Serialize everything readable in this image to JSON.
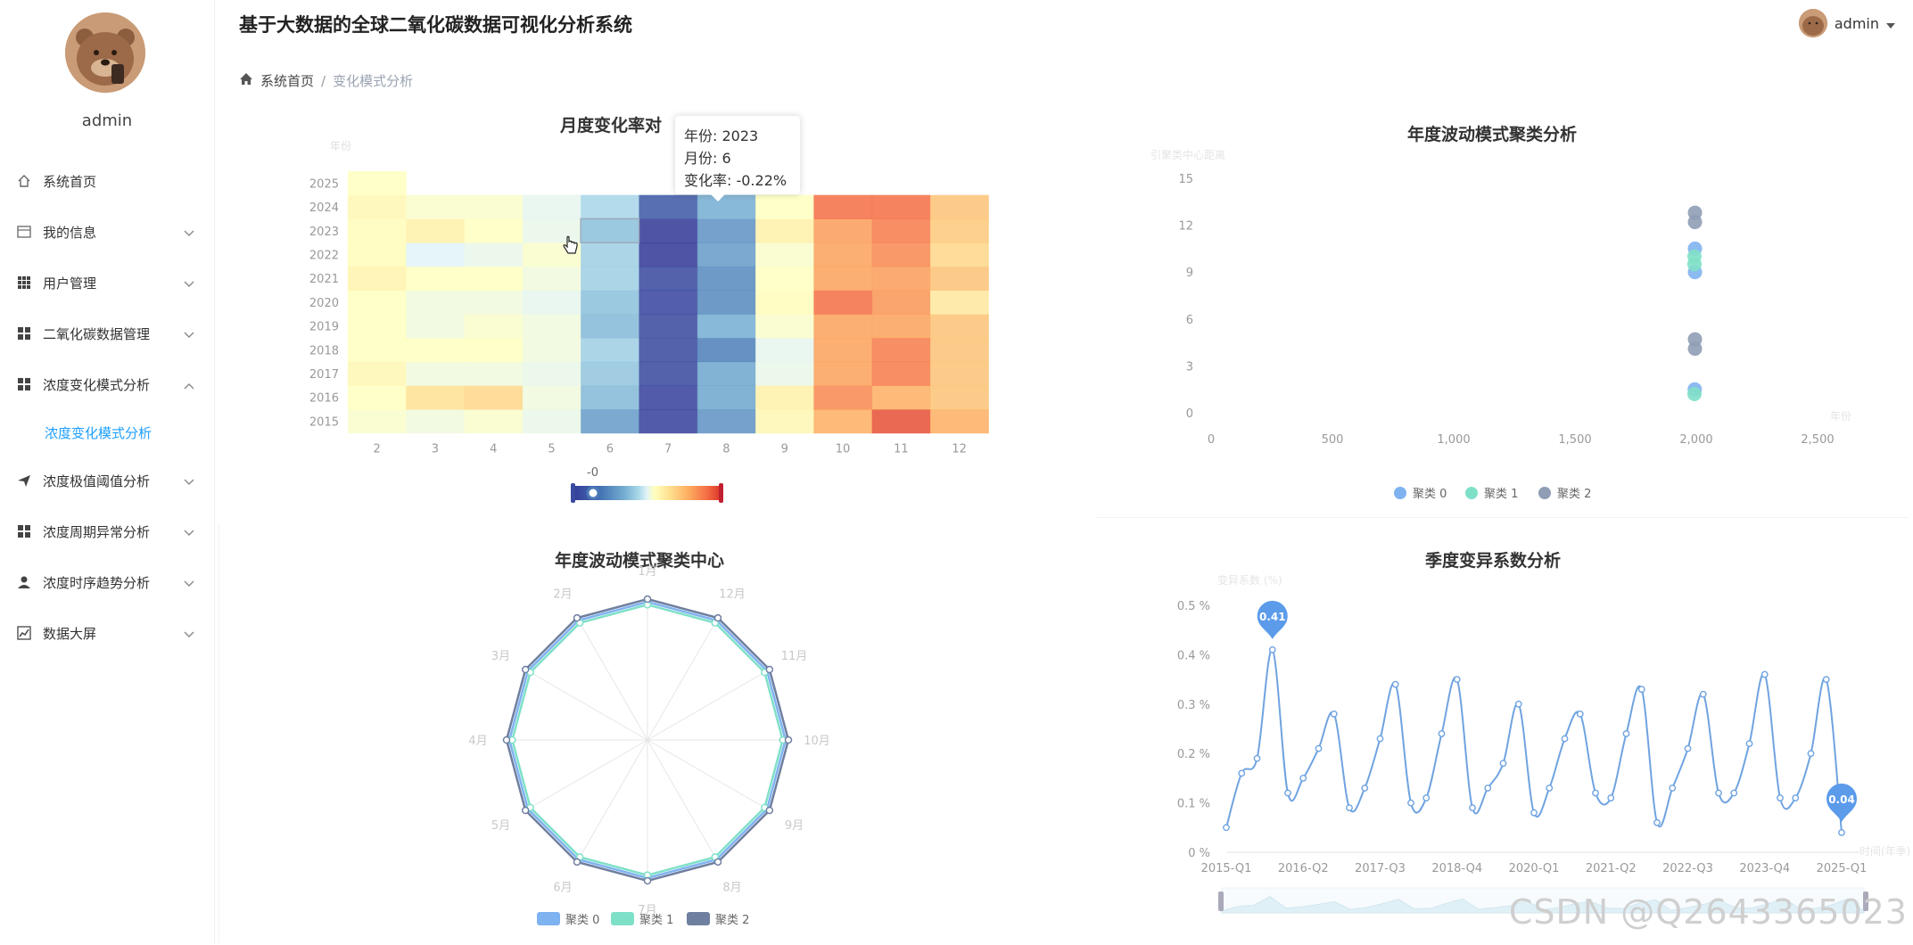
{
  "app": {
    "title": "基于大数据的全球二氧化碳数据可视化分析系统",
    "user": "admin"
  },
  "sidebar": {
    "user_name": "admin",
    "items": [
      {
        "label": "系统首页",
        "icon": "home-icon",
        "expandable": false
      },
      {
        "label": "我的信息",
        "icon": "card-icon",
        "expandable": true
      },
      {
        "label": "用户管理",
        "icon": "grid-icon",
        "expandable": true
      },
      {
        "label": "二氧化碳数据管理",
        "icon": "grid-icon",
        "expandable": true
      },
      {
        "label": "浓度变化模式分析",
        "icon": "grid-icon",
        "expandable": true,
        "expanded": true
      },
      {
        "label": "浓度变化模式分析",
        "icon": "",
        "sub": true,
        "active": true
      },
      {
        "label": "浓度极值阈值分析",
        "icon": "send-icon",
        "expandable": true
      },
      {
        "label": "浓度周期异常分析",
        "icon": "grid-icon",
        "expandable": true
      },
      {
        "label": "浓度时序趋势分析",
        "icon": "user-icon",
        "expandable": true
      },
      {
        "label": "数据大屏",
        "icon": "chart-icon",
        "expandable": true
      }
    ]
  },
  "breadcrumb": {
    "home": "系统首页",
    "sep": "/",
    "current": "变化模式分析"
  },
  "tooltip": {
    "line1": "年份: 2023",
    "line2": "月份: 6",
    "line3": "变化率: -0.22%"
  },
  "watermark": "CSDN @Q2643365023",
  "colors": {
    "accent": "#1e9fff",
    "line": "#6fa3e0",
    "cluster0": "#7fb2f0",
    "cluster1": "#7fe0c8",
    "cluster2": "#8f9db5"
  },
  "chart_data": [
    {
      "type": "heatmap",
      "title": "月度变化率对",
      "ylabel": "年份",
      "x": [
        "2",
        "3",
        "4",
        "5",
        "6",
        "7",
        "8",
        "9",
        "10",
        "11",
        "12"
      ],
      "y": [
        "2015",
        "2016",
        "2017",
        "2018",
        "2019",
        "2020",
        "2021",
        "2022",
        "2023",
        "2024",
        "2025"
      ],
      "visual_map_label": "-0",
      "values": [
        [
          0.08,
          0.05,
          0.08,
          0.03,
          -0.4,
          -0.95,
          -0.45,
          0.15,
          0.55,
          0.9,
          0.55
        ],
        [
          0.1,
          0.3,
          0.35,
          0.05,
          -0.25,
          -0.95,
          -0.35,
          0.2,
          0.7,
          0.55,
          0.45
        ],
        [
          0.15,
          0.05,
          0.05,
          0.03,
          -0.2,
          -0.9,
          -0.35,
          0.03,
          0.6,
          0.75,
          0.45
        ],
        [
          0.1,
          0.1,
          0.1,
          0.05,
          -0.15,
          -0.9,
          -0.55,
          0.02,
          0.6,
          0.75,
          0.45
        ],
        [
          0.1,
          0.05,
          0.08,
          0.05,
          -0.25,
          -0.9,
          -0.3,
          0.08,
          0.6,
          0.6,
          0.45
        ],
        [
          0.1,
          0.05,
          0.05,
          0.02,
          -0.22,
          -0.92,
          -0.5,
          0.12,
          0.8,
          0.65,
          0.25
        ],
        [
          0.18,
          0.1,
          0.1,
          0.05,
          -0.15,
          -0.9,
          -0.5,
          0.1,
          0.6,
          0.62,
          0.45
        ],
        [
          0.12,
          0.0,
          0.03,
          0.08,
          -0.15,
          -1.0,
          -0.4,
          0.08,
          0.6,
          0.7,
          0.35
        ],
        [
          0.12,
          0.2,
          0.1,
          0.03,
          -0.22,
          -1.0,
          -0.45,
          0.2,
          0.62,
          0.75,
          0.42
        ],
        [
          0.15,
          0.08,
          0.08,
          0.02,
          -0.12,
          -0.8,
          -0.3,
          0.1,
          0.8,
          0.8,
          0.45
        ],
        [
          0.1,
          null,
          null,
          null,
          null,
          null,
          null,
          null,
          null,
          null,
          null
        ]
      ]
    },
    {
      "type": "scatter",
      "title": "年度波动模式聚类分析",
      "ylabel": "引聚类中心距离",
      "xlabel": "年份",
      "xlim": [
        0,
        2500
      ],
      "ylim": [
        0,
        15
      ],
      "xticks": [
        "0",
        "500",
        "1,000",
        "1,500",
        "2,000",
        "2,500"
      ],
      "yticks": [
        "0",
        "3",
        "6",
        "9",
        "12",
        "15"
      ],
      "series": [
        {
          "name": "聚类 0",
          "points": [
            [
              2024,
              10.5
            ],
            [
              2024,
              9.0
            ],
            [
              2023,
              1.5
            ]
          ]
        },
        {
          "name": "聚类 1",
          "points": [
            [
              2022,
              10.0
            ],
            [
              2022,
              9.5
            ],
            [
              2022,
              1.2
            ]
          ]
        },
        {
          "name": "聚类 2",
          "points": [
            [
              2024,
              12.8
            ],
            [
              2024,
              12.2
            ],
            [
              2024,
              4.7
            ],
            [
              2024,
              4.1
            ]
          ]
        }
      ]
    },
    {
      "type": "radar",
      "title": "年度波动模式聚类中心",
      "indicators": [
        "1月",
        "12月",
        "11月",
        "10月",
        "9月",
        "8月",
        "7月",
        "6月",
        "5月",
        "4月",
        "3月",
        "2月"
      ],
      "series": [
        {
          "name": "聚类 0",
          "values": [
            0.98,
            0.98,
            0.98,
            0.98,
            0.98,
            0.98,
            0.98,
            0.98,
            0.98,
            0.98,
            0.98,
            0.98
          ]
        },
        {
          "name": "聚类 1",
          "values": [
            0.96,
            0.96,
            0.96,
            0.96,
            0.96,
            0.96,
            0.96,
            0.96,
            0.96,
            0.96,
            0.96,
            0.96
          ]
        },
        {
          "name": "聚类 2",
          "values": [
            1.0,
            1.0,
            1.0,
            1.0,
            1.0,
            1.0,
            1.0,
            1.0,
            1.0,
            1.0,
            1.0,
            1.0
          ]
        }
      ]
    },
    {
      "type": "line",
      "title": "季度变异系数分析",
      "ylabel": "变异系数 (%)",
      "xlabel": "时间(年季)",
      "ylim": [
        0,
        0.5
      ],
      "yticks": [
        "0 %",
        "0.1 %",
        "0.2 %",
        "0.3 %",
        "0.4 %",
        "0.5 %"
      ],
      "xticks": [
        "2015-Q1",
        "2016-Q2",
        "2017-Q3",
        "2018-Q4",
        "2020-Q1",
        "2021-Q2",
        "2022-Q3",
        "2023-Q4",
        "2025-Q1"
      ],
      "values": [
        0.05,
        0.16,
        0.19,
        0.41,
        0.12,
        0.15,
        0.21,
        0.28,
        0.09,
        0.13,
        0.23,
        0.34,
        0.1,
        0.11,
        0.24,
        0.35,
        0.09,
        0.13,
        0.18,
        0.3,
        0.08,
        0.13,
        0.23,
        0.28,
        0.12,
        0.11,
        0.24,
        0.33,
        0.06,
        0.13,
        0.21,
        0.32,
        0.12,
        0.12,
        0.22,
        0.36,
        0.11,
        0.11,
        0.2,
        0.35,
        0.04
      ],
      "markers": {
        "max": "0.41",
        "min": "0.04"
      }
    }
  ]
}
